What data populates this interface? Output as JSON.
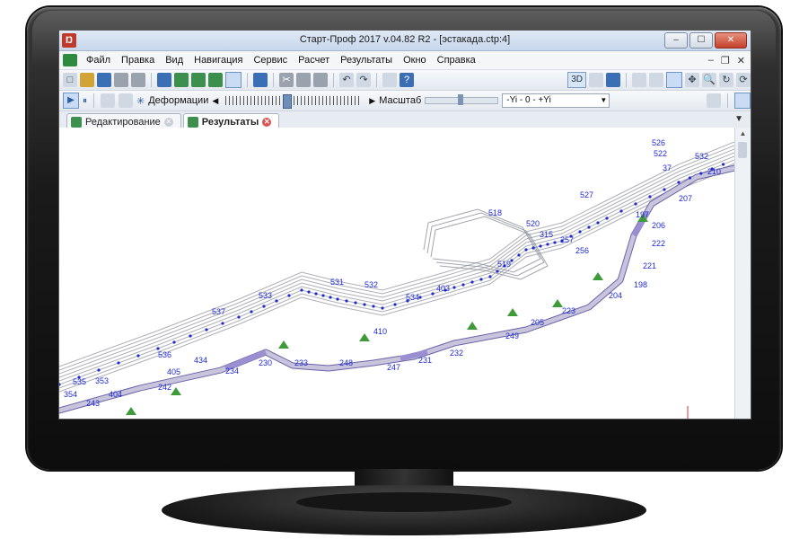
{
  "window": {
    "title": "Старт-Проф 2017 v.04.82 R2 - [эстакада.ctp:4]",
    "app_icon": "start-prof-logo-icon",
    "controls": [
      "minimize",
      "maximize",
      "close"
    ]
  },
  "menubar": {
    "items": [
      {
        "label": "Файл"
      },
      {
        "label": "Правка"
      },
      {
        "label": "Вид"
      },
      {
        "label": "Навигация"
      },
      {
        "label": "Сервис"
      },
      {
        "label": "Расчет"
      },
      {
        "label": "Результаты"
      },
      {
        "label": "Окно"
      },
      {
        "label": "Справка"
      }
    ]
  },
  "toolbar": {
    "view_3d_label": "3D"
  },
  "toolbar2": {
    "deformations_label": "Деформации",
    "scale_label": "Масштаб",
    "axis_value": "-Yi - 0 - +Yi"
  },
  "tabs": [
    {
      "label": "Редактирование",
      "active": false
    },
    {
      "label": "Результаты",
      "active": true
    }
  ],
  "model": {
    "node_labels": [
      {
        "text": "526"
      },
      {
        "text": "210"
      },
      {
        "text": "532"
      },
      {
        "text": "522"
      },
      {
        "text": "37"
      },
      {
        "text": "207"
      },
      {
        "text": "197"
      },
      {
        "text": "206"
      },
      {
        "text": "222"
      },
      {
        "text": "221"
      },
      {
        "text": "518"
      },
      {
        "text": "315"
      },
      {
        "text": "257"
      },
      {
        "text": "256"
      },
      {
        "text": "519"
      },
      {
        "text": "531"
      },
      {
        "text": "532"
      },
      {
        "text": "534"
      },
      {
        "text": "533"
      },
      {
        "text": "537"
      },
      {
        "text": "204"
      },
      {
        "text": "198"
      },
      {
        "text": "223"
      },
      {
        "text": "205"
      },
      {
        "text": "249"
      },
      {
        "text": "536"
      },
      {
        "text": "232"
      },
      {
        "text": "231"
      },
      {
        "text": "247"
      },
      {
        "text": "248"
      },
      {
        "text": "233"
      },
      {
        "text": "230"
      },
      {
        "text": "234"
      },
      {
        "text": "242"
      },
      {
        "text": "243"
      },
      {
        "text": "535"
      },
      {
        "text": "405"
      },
      {
        "text": "434"
      },
      {
        "text": "404"
      },
      {
        "text": "354"
      },
      {
        "text": "527"
      },
      {
        "text": "520"
      },
      {
        "text": "410"
      },
      {
        "text": "403"
      },
      {
        "text": "353"
      }
    ],
    "colors": {
      "pipe": "#c8c4dc",
      "pipe_highlight": "#9b8fd1",
      "label": "#1f2ad1",
      "structure": "#8a8f98",
      "support": "#3f9b3a"
    }
  }
}
